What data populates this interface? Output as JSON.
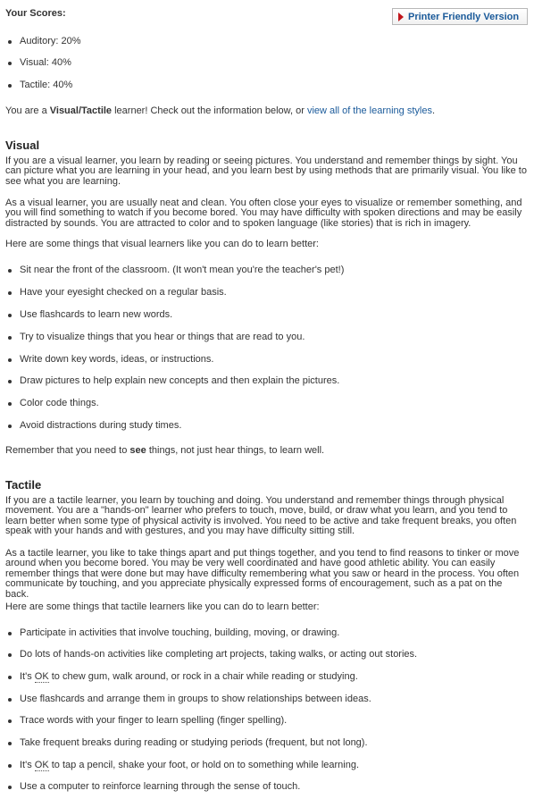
{
  "scores": {
    "title": "Your Scores:",
    "printer_button": "Printer Friendly Version",
    "items": [
      "Auditory: 20%",
      "Visual: 40%",
      "Tactile: 40%"
    ]
  },
  "result": {
    "prefix": "You are a ",
    "style": "Visual/Tactile",
    "middle": " learner! Check out the information below, or ",
    "link": "view all of the learning styles",
    "suffix": "."
  },
  "visual": {
    "heading": "Visual",
    "p1": "If you are a visual learner, you learn by reading or seeing pictures. You understand and remember things by sight. You can picture what you are learning in your head, and you learn best by using methods that are primarily visual. You like to see what you are learning.",
    "p2": "As a visual learner, you are usually neat and clean. You often close your eyes to visualize or remember something, and you will find something to watch if you become bored. You may have difficulty with spoken directions and may be easily distracted by sounds. You are attracted to color and to spoken language (like stories) that is rich in imagery.",
    "intro": "Here are some things that visual learners like you can do to learn better:",
    "tips": [
      "Sit near the front of the classroom. (It won't mean you're the teacher's pet!)",
      "Have your eyesight checked on a regular basis.",
      "Use flashcards to learn new words.",
      "Try to visualize things that you hear or things that are read to you.",
      "Write down key words, ideas, or instructions.",
      "Draw pictures to help explain new concepts and then explain the pictures.",
      "Color code things.",
      "Avoid distractions during study times."
    ],
    "remember_prefix": "Remember that you need to ",
    "remember_bold": "see",
    "remember_suffix": " things, not just hear things, to learn well."
  },
  "tactile": {
    "heading": "Tactile",
    "p1": "If you are a tactile learner, you learn by touching and doing. You understand and remember things through physical movement. You are a \"hands-on\" learner who prefers to touch, move, build, or draw what you learn, and you tend to learn better when some type of physical activity is involved. You need to be active and take frequent breaks, you often speak with your hands and with gestures, and you may have difficulty sitting still.",
    "p2": "As a tactile learner, you like to take things apart and put things together, and you tend to find reasons to tinker or move around when you become bored. You may be very well coordinated and have good athletic ability. You can easily remember things that were done but may have difficulty remembering what you saw or heard in the process. You often communicate by touching, and you appreciate physically expressed forms of encouragement, such as a pat on the back.",
    "intro": "Here are some things that tactile learners like you can do to learn better:",
    "tips": [
      "Participate in activities that involve touching, building, moving, or drawing.",
      "Do lots of hands-on activities like completing art projects, taking walks, or acting out stories.",
      "to chew gum, walk around, or rock in a chair while reading or studying.",
      "Use flashcards and arrange them in groups to show relationships between ideas.",
      "Trace words with your finger to learn spelling (finger spelling).",
      "Take frequent breaks during reading or studying periods (frequent, but not long).",
      "to tap a pencil, shake your foot, or hold on to something while learning.",
      "Use a computer to reinforce learning through the sense of touch."
    ],
    "its": "It's ",
    "ok": "OK"
  },
  "colors": {
    "link": "#1a5a9a",
    "printer_arrow": "#c0151b"
  }
}
